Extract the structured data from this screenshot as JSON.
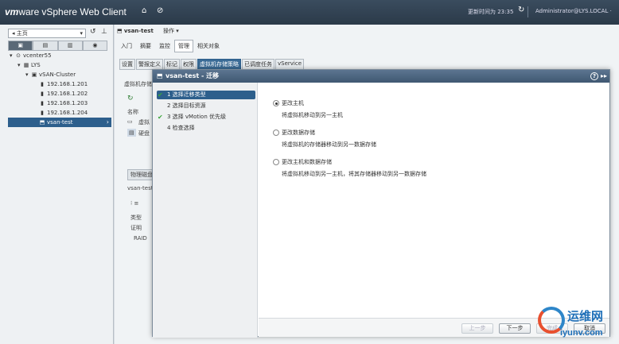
{
  "topbar": {
    "brand_vm": "vm",
    "brand_ware": "ware",
    "product": "vSphere Web Client",
    "update_time": "更新时间为 23:35",
    "user": "Administrator@LYS.LOCAL ·"
  },
  "nav": {
    "home": "主页",
    "tabs": [
      "▣",
      "▤",
      "▥",
      "◉"
    ],
    "tree": [
      {
        "label": "vcenter55",
        "indent": 0,
        "icon": "⊙",
        "arrow": "▾"
      },
      {
        "label": "LYS",
        "indent": 1,
        "icon": "▦",
        "arrow": "▾"
      },
      {
        "label": "vSAN-Cluster",
        "indent": 2,
        "icon": "▣",
        "arrow": "▾"
      },
      {
        "label": "192.168.1.201",
        "indent": 3,
        "icon": "▮",
        "arrow": ""
      },
      {
        "label": "192.168.1.202",
        "indent": 3,
        "icon": "▮",
        "arrow": ""
      },
      {
        "label": "192.168.1.203",
        "indent": 3,
        "icon": "▮",
        "arrow": ""
      },
      {
        "label": "192.168.1.204",
        "indent": 3,
        "icon": "▮",
        "arrow": ""
      },
      {
        "label": "vsan-test",
        "indent": 3,
        "icon": "⬒",
        "arrow": "",
        "selected": true
      }
    ]
  },
  "main": {
    "object_name": "vsan-test",
    "actions": "操作 ▾",
    "tabs": [
      "入门",
      "摘要",
      "监控",
      "管理",
      "相关对象"
    ],
    "active_tab": 3,
    "subtabs": [
      "设置",
      "警报定义",
      "标记",
      "权限",
      "虚拟机存储策略",
      "已调度任务",
      "vService"
    ],
    "active_subtab": 4,
    "ghost": {
      "vm_storage": "虚拟机存储",
      "name_col": "名称",
      "vm_item": "虚拟",
      "disk_item": "硬盘",
      "phys_tab": "物理磁盘",
      "vsan_test": "vsan-test",
      "type_col": "类型",
      "proof": "证明",
      "raid": "RAID"
    }
  },
  "dialog": {
    "title": "vsan-test - 迁移",
    "steps": [
      {
        "label": "1  选择迁移类型",
        "checked": true,
        "current": true
      },
      {
        "label": "2  选择目标资源",
        "checked": false,
        "current": false
      },
      {
        "label": "3  选择 vMotion 优先级",
        "checked": true,
        "current": false
      },
      {
        "label": "4  检查选择",
        "checked": false,
        "current": false
      }
    ],
    "options": [
      {
        "label": "更改主机",
        "desc": "将虚拟机移动到另一主机",
        "selected": true
      },
      {
        "label": "更改数据存储",
        "desc": "将虚拟机的存储器移动到另一数据存储",
        "selected": false
      },
      {
        "label": "更改主机和数据存储",
        "desc": "将虚拟机移动到另一主机，将其存储器移动到另一数据存储",
        "selected": false
      }
    ],
    "buttons": {
      "back": "上一步",
      "next": "下一步",
      "finish": "完成",
      "cancel": "取消"
    }
  },
  "watermark": {
    "cn": "运维网",
    "url": "iyunv.com"
  }
}
